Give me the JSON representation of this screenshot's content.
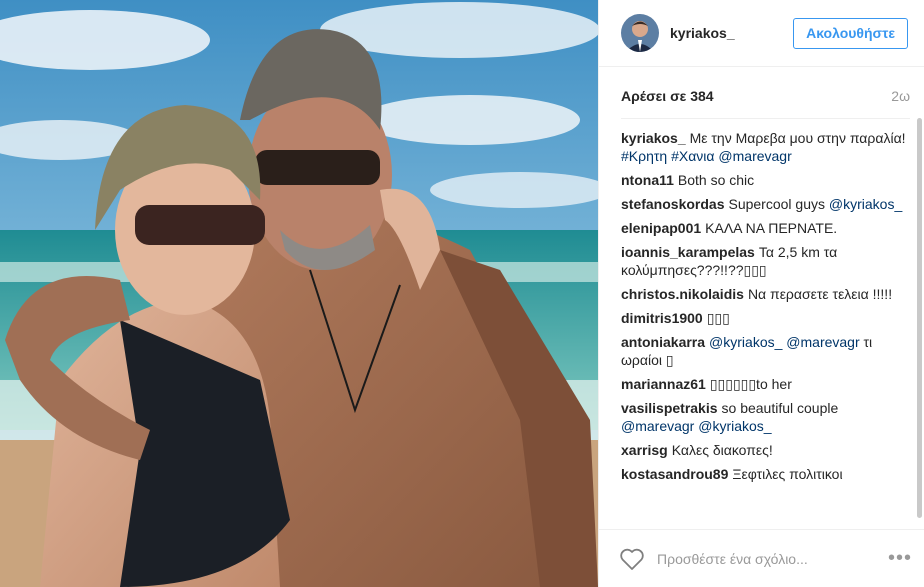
{
  "post": {
    "username": "kyriakos_",
    "follow_label": "Ακολουθήστε",
    "likes": "Αρέσει σε 384",
    "time": "2ω",
    "add_comment_placeholder": "Προσθέστε ένα σχόλιο...",
    "more_label": "•••"
  },
  "comments": [
    {
      "user": "kyriakos_",
      "parts": [
        {
          "t": "Με την Μαρεβα μου στην παραλία! "
        },
        {
          "t": "#Κρητη",
          "tag": true
        },
        {
          "t": " "
        },
        {
          "t": "#Χανια",
          "tag": true
        },
        {
          "t": " "
        },
        {
          "t": "@marevagr",
          "tag": true
        }
      ]
    },
    {
      "user": "ntona11",
      "parts": [
        {
          "t": "Both so chic"
        }
      ]
    },
    {
      "user": "stefanoskordas",
      "parts": [
        {
          "t": "Supercool guys "
        },
        {
          "t": "@kyriakos_",
          "tag": true
        }
      ]
    },
    {
      "user": "elenipap001",
      "parts": [
        {
          "t": "ΚΑΛΑ ΝΑ ΠΕΡΝΑΤΕ."
        }
      ]
    },
    {
      "user": "ioannis_karampelas",
      "parts": [
        {
          "t": "Τα 2,5 km τα κολύμπησες???!!??▯▯▯"
        }
      ]
    },
    {
      "user": "christos.nikolaidis",
      "parts": [
        {
          "t": "Να περασετε τελεια !!!!!"
        }
      ]
    },
    {
      "user": "dimitris1900",
      "parts": [
        {
          "t": "▯▯▯"
        }
      ]
    },
    {
      "user": "antoniakarra",
      "parts": [
        {
          "t": "@kyriakos_",
          "tag": true
        },
        {
          "t": " "
        },
        {
          "t": "@marevagr",
          "tag": true
        },
        {
          "t": " τι ωραίοι ▯"
        }
      ]
    },
    {
      "user": "mariannaz61",
      "parts": [
        {
          "t": "▯▯▯▯▯▯to her"
        }
      ]
    },
    {
      "user": "vasilispetrakis",
      "parts": [
        {
          "t": "so beautiful couple "
        },
        {
          "t": "@marevagr",
          "tag": true
        },
        {
          "t": " "
        },
        {
          "t": "@kyriakos_",
          "tag": true
        }
      ]
    },
    {
      "user": "xarrisg",
      "parts": [
        {
          "t": "Καλες διακοπες!"
        }
      ]
    },
    {
      "user": "kostasandrou89",
      "parts": [
        {
          "t": "Ξεφτιλες πολιτικοι"
        }
      ]
    }
  ],
  "colors": {
    "accent": "#3897f0",
    "tag": "#003569",
    "muted": "#999999"
  },
  "icons": {
    "like": "heart-outline-icon",
    "more": "more-options-icon"
  }
}
